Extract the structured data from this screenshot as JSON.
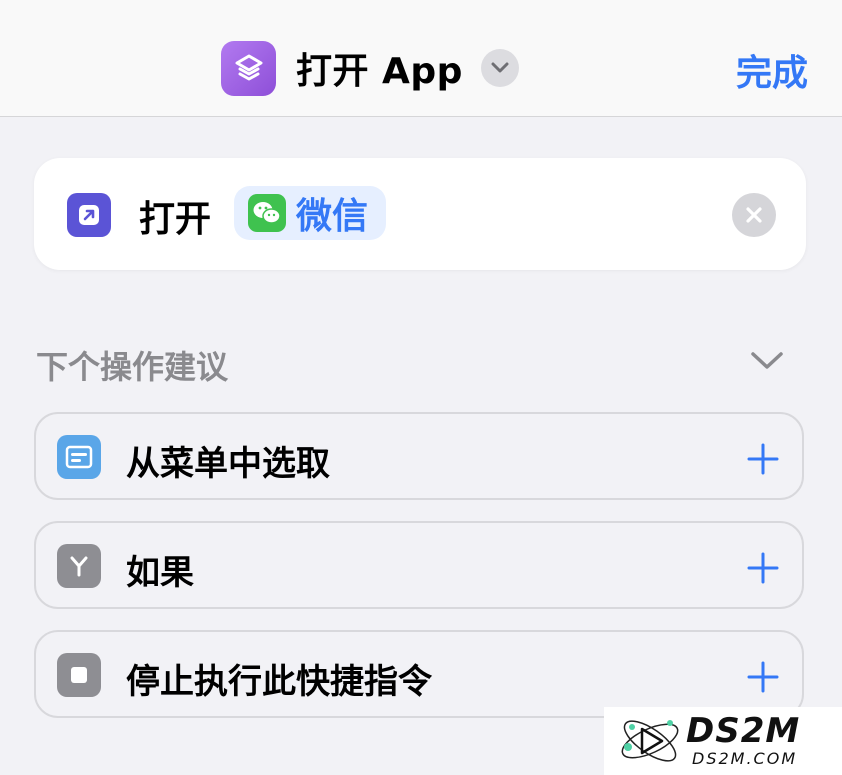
{
  "nav": {
    "title": "打开 App",
    "done_label": "完成"
  },
  "action": {
    "verb": "打开",
    "app_param": "微信"
  },
  "suggestions": {
    "header": "下个操作建议",
    "items": [
      {
        "label": "从菜单中选取",
        "icon": "menu-choose-icon",
        "icon_color": "#5aa6e8"
      },
      {
        "label": "如果",
        "icon": "if-branch-icon",
        "icon_color": "#8e8e93"
      },
      {
        "label": "停止执行此快捷指令",
        "icon": "stop-icon",
        "icon_color": "#8e8e93"
      }
    ]
  },
  "watermark": {
    "text": "DS2M",
    "sub": "DS2M.COM"
  },
  "colors": {
    "accent": "#3478f6",
    "shortcuts_purple": "#9c63e6",
    "open_app_indigo": "#5b54d6",
    "wechat_green": "#3fc24f"
  }
}
